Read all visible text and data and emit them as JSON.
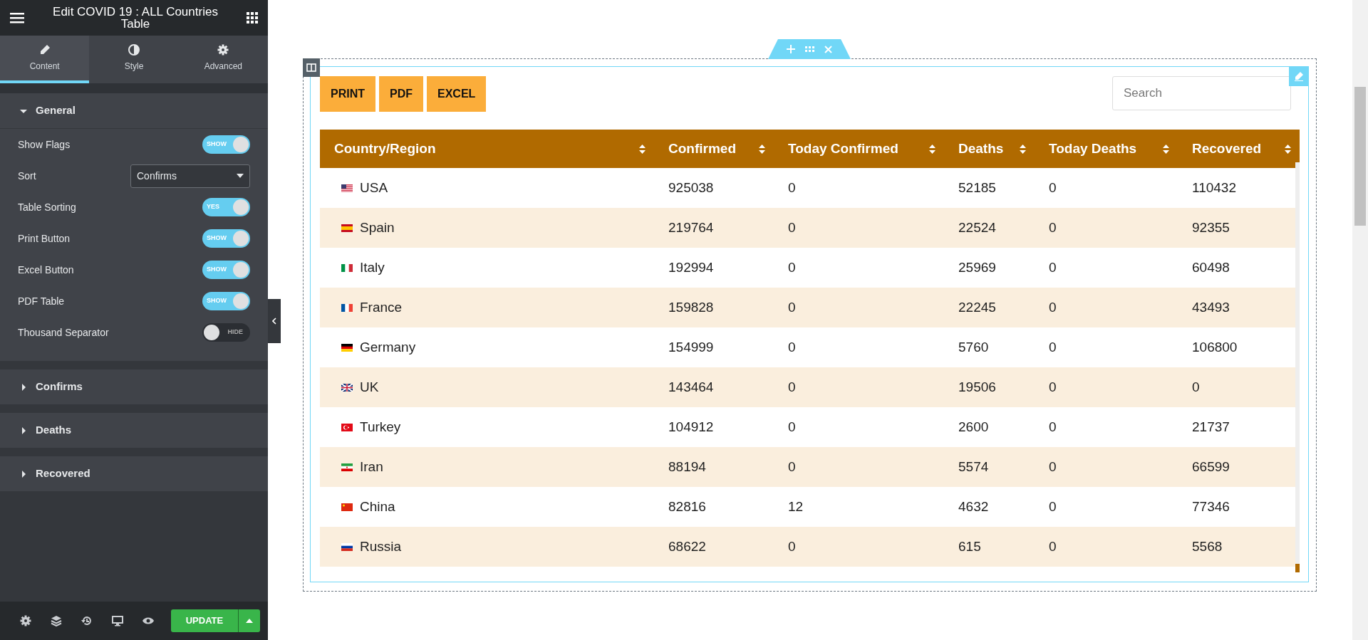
{
  "panel": {
    "title": "Edit COVID 19 : ALL Countries Table",
    "tabs": [
      {
        "label": "Content",
        "selected": true,
        "kind": "pencil"
      },
      {
        "label": "Style",
        "selected": false,
        "kind": "contrast"
      },
      {
        "label": "Advanced",
        "selected": false,
        "kind": "gear"
      }
    ],
    "sections": [
      {
        "title": "General",
        "expanded": true,
        "controls": [
          {
            "kind": "toggle",
            "label": "Show Flags",
            "on": true,
            "text": "SHOW"
          },
          {
            "kind": "select",
            "label": "Sort",
            "value": "Confirms"
          },
          {
            "kind": "toggle",
            "label": "Table Sorting",
            "on": true,
            "text": "YES"
          },
          {
            "kind": "toggle",
            "label": "Print Button",
            "on": true,
            "text": "SHOW"
          },
          {
            "kind": "toggle",
            "label": "Excel Button",
            "on": true,
            "text": "SHOW"
          },
          {
            "kind": "toggle",
            "label": "PDF Table",
            "on": true,
            "text": "SHOW"
          },
          {
            "kind": "toggle",
            "label": "Thousand Separator",
            "on": false,
            "text": "HIDE"
          }
        ]
      },
      {
        "title": "Confirms",
        "expanded": false
      },
      {
        "title": "Deaths",
        "expanded": false
      },
      {
        "title": "Recovered",
        "expanded": false
      }
    ],
    "footer": {
      "update_button": "UPDATE"
    }
  },
  "canvas": {
    "buttons": [
      "PRINT",
      "PDF",
      "EXCEL"
    ],
    "search": {
      "placeholder": "Search"
    },
    "table": {
      "columns": [
        "Country/Region",
        "Confirmed",
        "Today Confirmed",
        "Deaths",
        "Today Deaths",
        "Recovered"
      ],
      "rows": [
        {
          "kind": "us",
          "cells": [
            "USA",
            "925038",
            "0",
            "52185",
            "0",
            "110432"
          ]
        },
        {
          "kind": "es",
          "cells": [
            "Spain",
            "219764",
            "0",
            "22524",
            "0",
            "92355"
          ]
        },
        {
          "kind": "it",
          "cells": [
            "Italy",
            "192994",
            "0",
            "25969",
            "0",
            "60498"
          ]
        },
        {
          "kind": "fr",
          "cells": [
            "France",
            "159828",
            "0",
            "22245",
            "0",
            "43493"
          ]
        },
        {
          "kind": "de",
          "cells": [
            "Germany",
            "154999",
            "0",
            "5760",
            "0",
            "106800"
          ]
        },
        {
          "kind": "gb",
          "cells": [
            "UK",
            "143464",
            "0",
            "19506",
            "0",
            "0"
          ]
        },
        {
          "kind": "tr",
          "cells": [
            "Turkey",
            "104912",
            "0",
            "2600",
            "0",
            "21737"
          ]
        },
        {
          "kind": "ir",
          "cells": [
            "Iran",
            "88194",
            "0",
            "5574",
            "0",
            "66599"
          ]
        },
        {
          "kind": "cn",
          "cells": [
            "China",
            "82816",
            "12",
            "4632",
            "0",
            "77346"
          ]
        },
        {
          "kind": "ru",
          "cells": [
            "Russia",
            "68622",
            "0",
            "615",
            "0",
            "5568"
          ]
        }
      ]
    }
  }
}
